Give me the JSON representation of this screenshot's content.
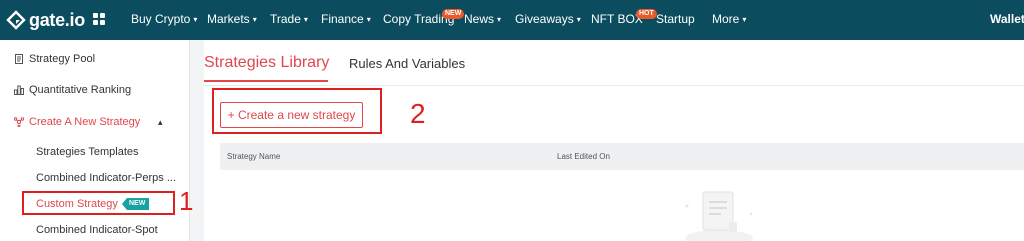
{
  "topnav": {
    "logo_text": "gate.io",
    "items": [
      {
        "label": "Buy Crypto",
        "caret": "▾"
      },
      {
        "label": "Markets",
        "caret": "▾"
      },
      {
        "label": "Trade",
        "caret": "▾"
      },
      {
        "label": "Finance",
        "caret": "▾"
      },
      {
        "label": "Copy Trading",
        "badge": "NEW"
      },
      {
        "label": "News",
        "caret": "▾"
      },
      {
        "label": "Giveaways",
        "caret": "▾"
      },
      {
        "label": "NFT BOX",
        "badge": "HOT"
      },
      {
        "label": "Startup"
      },
      {
        "label": "More",
        "caret": "▾"
      }
    ],
    "wallet": "Wallet",
    "colors": {
      "bg": "#0b4d5e",
      "badge": "#e85a2a"
    }
  },
  "sidebar": {
    "items": [
      {
        "label": "Strategy Pool",
        "icon": "document-icon"
      },
      {
        "label": "Quantitative Ranking",
        "icon": "bar-chart-icon"
      },
      {
        "label": "Create A New Strategy",
        "icon": "network-icon",
        "expanded_chevron": "▴"
      }
    ],
    "sub_items": [
      {
        "label": "Strategies Templates"
      },
      {
        "label": "Combined Indicator-Perps ..."
      },
      {
        "label": "Custom Strategy",
        "tag": "NEW"
      },
      {
        "label": "Combined Indicator-Spot"
      }
    ],
    "active_color": "#e0474c"
  },
  "main": {
    "tabs": [
      {
        "label": "Strategies Library",
        "active": true
      },
      {
        "label": "Rules And Variables",
        "active": false
      }
    ],
    "create_button": "+ Create a new strategy",
    "table": {
      "columns": [
        "Strategy Name",
        "Last Edited On"
      ]
    }
  },
  "annotations": {
    "one": "1",
    "two": "2",
    "color": "#e02020"
  }
}
